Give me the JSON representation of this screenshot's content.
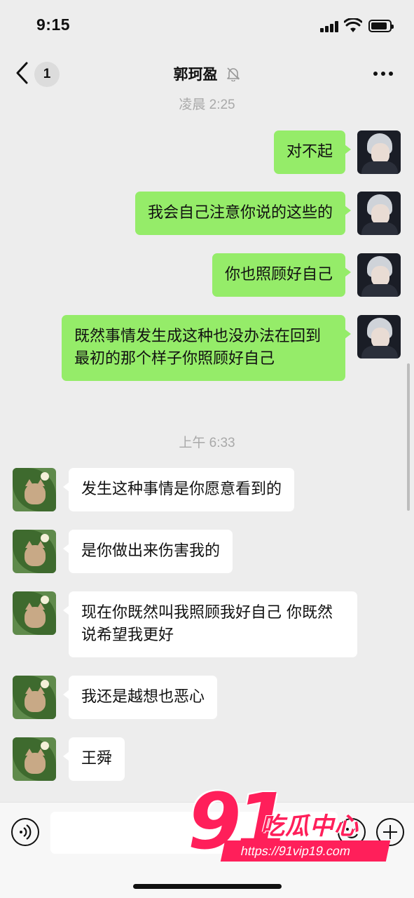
{
  "status_bar": {
    "time": "9:15"
  },
  "nav": {
    "unread_count": "1",
    "title": "郭珂盈"
  },
  "timestamps": [
    "凌晨 2:25",
    "上午 6:33"
  ],
  "messages": [
    {
      "sender": "me",
      "text": "对不起"
    },
    {
      "sender": "me",
      "text": "我会自己注意你说的这些的"
    },
    {
      "sender": "me",
      "text": "你也照顾好自己"
    },
    {
      "sender": "me",
      "text": "既然事情发生成这种也没办法在回到最初的那个样子你照顾好自己"
    },
    {
      "sender": "other",
      "text": "发生这种事情是你愿意看到的"
    },
    {
      "sender": "other",
      "text": "是你做出来伤害我的"
    },
    {
      "sender": "other",
      "text": "现在你既然叫我照顾我好自己 你既然说希望我更好"
    },
    {
      "sender": "other",
      "text": "我还是越想也恶心"
    },
    {
      "sender": "other",
      "text": "王舜"
    }
  ],
  "watermark": {
    "number": "91",
    "brand": "吃瓜中心",
    "url": "https://91vip19.com"
  },
  "colors": {
    "outgoing_bubble": "#95ec69",
    "incoming_bubble": "#ffffff",
    "background": "#ededed",
    "watermark": "#ff1f5a"
  },
  "icons": [
    "back-chevron-icon",
    "mute-bell-icon",
    "more-dots-icon",
    "voice-icon",
    "emoji-icon",
    "plus-icon",
    "signal-icon",
    "wifi-icon",
    "battery-icon"
  ]
}
